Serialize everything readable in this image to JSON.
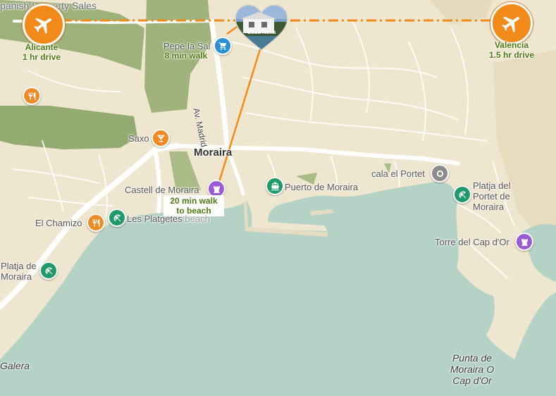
{
  "colors": {
    "land": "#efe6cf",
    "sea": "#b5d2c6",
    "park": "#96ad72",
    "route_orange": "#f28a1a",
    "note_green": "#4d7a12",
    "pin_orange": "#f08a24",
    "pin_teal": "#1f9a6c",
    "pin_purple": "#9b5ad1",
    "pin_blue": "#2a8fd6",
    "pin_gray": "#8c8c8c"
  },
  "header": {
    "partial_text": "panish Property Sales"
  },
  "airports": {
    "alicante": {
      "name": "Alicante",
      "drive": "1 hr drive",
      "icon": "airplane-icon"
    },
    "valencia": {
      "name": "Valencia",
      "drive": "1.5 hr drive",
      "icon": "airplane-icon"
    }
  },
  "property": {
    "name": "Casa Nella",
    "icon": "heart-photo-marker"
  },
  "shop": {
    "name": "Pepe la Sal",
    "walk": "8 min walk",
    "icon": "shopping-cart-icon"
  },
  "streets": {
    "av_madrid": "Av. Madrid"
  },
  "town": {
    "name": "Moraira"
  },
  "pois": {
    "saxo": {
      "name": "Saxo",
      "icon": "cocktail-icon"
    },
    "castell": {
      "name": "Castell de Moraira",
      "note_line1": "20 min walk",
      "note_line2": "to beach",
      "icon": "castle-icon"
    },
    "puerto": {
      "name": "Puerto de Moraira",
      "icon": "boat-icon"
    },
    "cala_portet": {
      "name": "cala el Portet",
      "icon": "circle-marker-icon"
    },
    "platja_portet": {
      "line1": "Platja del",
      "line2": "Portet de",
      "line3": "Moraira",
      "icon": "beach-umbrella-icon"
    },
    "el_chamizo": {
      "name": "El Chamizo",
      "icon": "restaurant-icon"
    },
    "les_platgetes": {
      "name": "Les Platgetes",
      "suffix": "beach",
      "icon": "beach-umbrella-icon"
    },
    "platja_de_moraira": {
      "line1": "Platja de",
      "line2": "Moraira",
      "icon": "beach-umbrella-icon"
    },
    "torre_cap": {
      "name": "Torre del Cap d'Or",
      "icon": "castle-icon"
    },
    "punta": {
      "line1": "Punta de",
      "line2": "Moraira O",
      "line3": "Cap d'Or"
    },
    "galera": {
      "name": "Galera"
    },
    "restaurant_top": {
      "icon": "restaurant-icon"
    }
  }
}
